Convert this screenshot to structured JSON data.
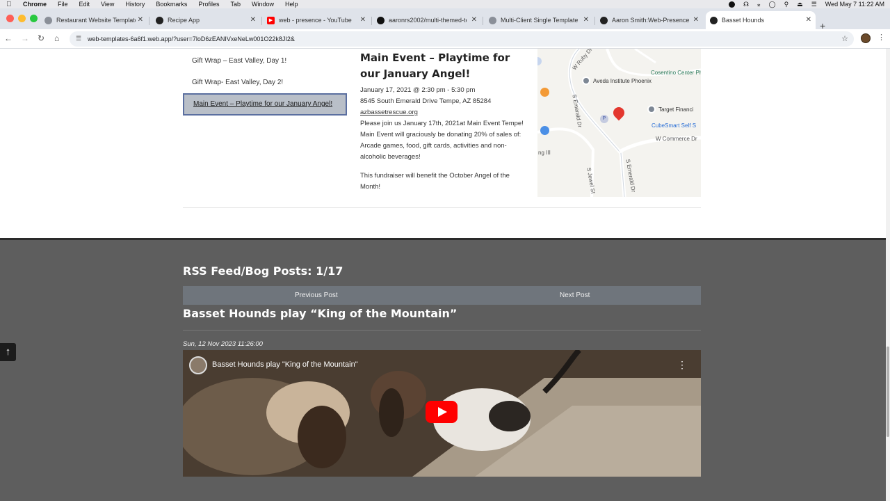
{
  "menubar": {
    "app": "Chrome",
    "items": [
      "File",
      "Edit",
      "View",
      "History",
      "Bookmarks",
      "Profiles",
      "Tab",
      "Window",
      "Help"
    ],
    "datetime": "Wed May 7  11:22 AM"
  },
  "tabs": [
    {
      "title": "Restaurant Website Template"
    },
    {
      "title": "Recipe App"
    },
    {
      "title": "web - presence - YouTube"
    },
    {
      "title": "aaronrs2002/multi-themed-te"
    },
    {
      "title": "Multi-Client Single Template"
    },
    {
      "title": "Aaron Smith:Web-Presence L"
    },
    {
      "title": "Basset Hounds"
    }
  ],
  "address": {
    "url": "web-templates-6a6f1.web.app/?user=7loD6zEANIVxeNeLw001O22k8JI2&"
  },
  "events": {
    "items": [
      {
        "label": "Gift Wrap – East Valley, Day 1!"
      },
      {
        "label": "Gift Wrap- East Valley, Day 2!"
      },
      {
        "label": "Main Event – Playtime for our January Angel!"
      }
    ],
    "detail": {
      "title": "Main Event – Playtime for our January Angel!",
      "when": "January 17, 2021 @ 2:30 pm - 5:30 pm",
      "address": "8545 South Emerald Drive Tempe, AZ 85284",
      "link": "azbassetrescue.org",
      "body": "Please join us January 17th, 2021at Main Event Tempe! Main Event will graciously be donating 20% of sales of: Arcade games, food, gift cards, activities and non-alcoholic beverages!",
      "note": "This fundraiser will benefit the October Angel of the Month!"
    }
  },
  "map": {
    "labels": {
      "ruby": "W Ruby Dr",
      "cosentino": "Cosentino Center Phoe",
      "aveda": "Aveda Institute Phoenix",
      "target": "Target Financi",
      "cubesmart": "CubeSmart Self S",
      "commerce": "W Commerce Dr",
      "emerald1": "S Emerald Dr",
      "emerald2": "S Emerald Dr",
      "jewel": "S Jewel St",
      "ng": "ng III"
    }
  },
  "rss": {
    "heading": "RSS Feed/Bog Posts: 1/17",
    "prev": "Previous Post",
    "next": "Next Post",
    "post_title": "Basset Hounds play “King of the Mountain”",
    "date": "Sun, 12 Nov 2023 11:26:00",
    "video_title": "Basset Hounds play \"King of the Mountain\""
  },
  "colors": {
    "footer_bg": "#5e5e5e",
    "postnav_bg": "#6f757c",
    "selected_item_bg": "#b9bfc8",
    "youtube_red": "#ff0000"
  }
}
